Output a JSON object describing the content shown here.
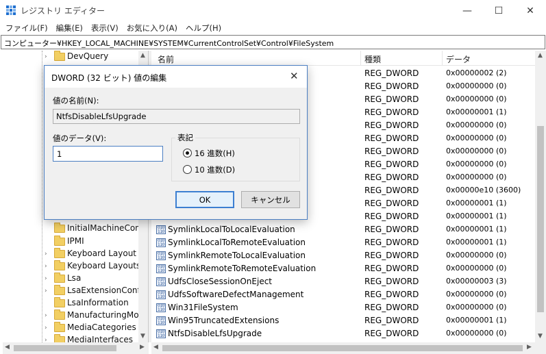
{
  "window": {
    "title": "レジストリ エディター",
    "minimize_glyph": "—",
    "maximize_glyph": "☐",
    "close_glyph": "✕"
  },
  "menu": [
    "ファイル(F)",
    "編集(E)",
    "表示(V)",
    "お気に入り(A)",
    "ヘルプ(H)"
  ],
  "address": "コンピューター¥HKEY_LOCAL_MACHINE¥SYSTEM¥CurrentControlSet¥Control¥FileSystem",
  "tree": {
    "items": [
      {
        "label": "DevQuery",
        "expander": "›"
      },
      {
        "label": "InitialMachineConf",
        "expander": ""
      },
      {
        "label": "IPMI",
        "expander": ""
      },
      {
        "label": "Keyboard Layout",
        "expander": "›"
      },
      {
        "label": "Keyboard Layouts",
        "expander": "›"
      },
      {
        "label": "Lsa",
        "expander": "›"
      },
      {
        "label": "LsaExtensionConfig",
        "expander": "›"
      },
      {
        "label": "LsaInformation",
        "expander": ""
      },
      {
        "label": "ManufacturingMod",
        "expander": "›"
      },
      {
        "label": "MediaCategories",
        "expander": "›"
      },
      {
        "label": "MediaInterfaces",
        "expander": "›"
      }
    ]
  },
  "list": {
    "columns": {
      "name": "名前",
      "type": "種類",
      "data": "データ"
    },
    "rows": [
      {
        "name": "",
        "type": "REG_DWORD",
        "data": "0x00000002 (2)"
      },
      {
        "name": "",
        "type": "REG_DWORD",
        "data": "0x00000000 (0)"
      },
      {
        "name": "",
        "type": "REG_DWORD",
        "data": "0x00000000 (0)"
      },
      {
        "name": "",
        "type": "REG_DWORD",
        "data": "0x00000001 (1)"
      },
      {
        "name": "",
        "type": "REG_DWORD",
        "data": "0x00000000 (0)"
      },
      {
        "name": "",
        "type": "REG_DWORD",
        "data": "0x00000000 (0)"
      },
      {
        "name": "",
        "type": "REG_DWORD",
        "data": "0x00000000 (0)"
      },
      {
        "name": "",
        "type": "REG_DWORD",
        "data": "0x00000000 (0)"
      },
      {
        "name": "",
        "type": "REG_DWORD",
        "data": "0x00000000 (0)"
      },
      {
        "name": "",
        "type": "REG_DWORD",
        "data": "0x00000e10 (3600)"
      },
      {
        "name": "",
        "type": "REG_DWORD",
        "data": "0x00000001 (1)"
      },
      {
        "name": "",
        "type": "REG_DWORD",
        "data": "0x00000001 (1)"
      },
      {
        "name": "SymlinkLocalToLocalEvaluation",
        "type": "REG_DWORD",
        "data": "0x00000001 (1)"
      },
      {
        "name": "SymlinkLocalToRemoteEvaluation",
        "type": "REG_DWORD",
        "data": "0x00000001 (1)"
      },
      {
        "name": "SymlinkRemoteToLocalEvaluation",
        "type": "REG_DWORD",
        "data": "0x00000000 (0)"
      },
      {
        "name": "SymlinkRemoteToRemoteEvaluation",
        "type": "REG_DWORD",
        "data": "0x00000000 (0)"
      },
      {
        "name": "UdfsCloseSessionOnEject",
        "type": "REG_DWORD",
        "data": "0x00000003 (3)"
      },
      {
        "name": "UdfsSoftwareDefectManagement",
        "type": "REG_DWORD",
        "data": "0x00000000 (0)"
      },
      {
        "name": "Win31FileSystem",
        "type": "REG_DWORD",
        "data": "0x00000000 (0)"
      },
      {
        "name": "Win95TruncatedExtensions",
        "type": "REG_DWORD",
        "data": "0x00000001 (1)"
      },
      {
        "name": "NtfsDisableLfsUpgrade",
        "type": "REG_DWORD",
        "data": "0x00000000 (0)"
      }
    ]
  },
  "dialog": {
    "title": "DWORD (32 ビット) 値の編集",
    "value_name_label": "値の名前(N):",
    "value_name": "NtfsDisableLfsUpgrade",
    "value_data_label": "値のデータ(V):",
    "value_data": "1",
    "base_group_label": "表記",
    "radio_hex": "16 進数(H)",
    "radio_dec": "10 進数(D)",
    "selected_base": "hex",
    "ok_label": "OK",
    "cancel_label": "キャンセル"
  }
}
